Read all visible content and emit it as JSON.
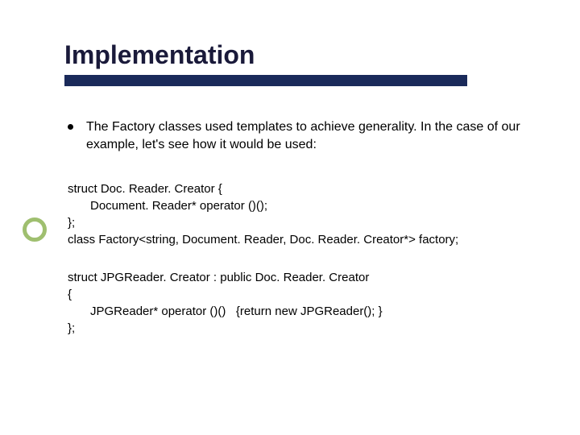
{
  "title": "Implementation",
  "bullet": {
    "text": "The Factory classes used templates to achieve generality.  In the case of our example, let's see how it would be used:"
  },
  "code1": {
    "l1": "struct Doc. Reader. Creator {",
    "l2": "Document. Reader* operator ()();",
    "l3": "};",
    "l4": "class Factory<string, Document. Reader, Doc. Reader. Creator*> factory;"
  },
  "code2": {
    "l1": "struct JPGReader. Creator : public Doc. Reader. Creator",
    "l2": "{",
    "l3": "JPGReader* operator ()()   {return new JPGReader(); }",
    "l4": "};"
  }
}
